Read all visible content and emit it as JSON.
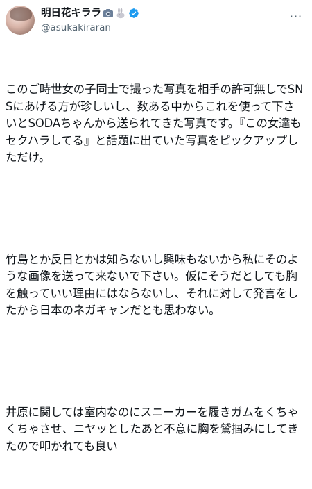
{
  "post": {
    "display_name": "明日花キララ",
    "handle": "@asukakiraran",
    "more_label": "···",
    "icons": {
      "verified": "verified-badge-icon",
      "more": "more-options-icon",
      "emoji1": "camera-emoji-icon",
      "emoji2": "rabbit-emoji-icon"
    },
    "accent_color": "#1d9bf0",
    "paragraphs": [
      "このご時世女の子同士で撮った写真を相手の許可無しでSNSにあげる方が珍しいし、数ある中からこれを使って下さいとSODAちゃんから送られてきた写真です。『この女達もセクハラしてる』と話題に出ていた写真をピックアップしただけ。",
      "竹島とか反日とかは知らないし興味もないから私にそのような画像を送って来ないで下さい。仮にそうだとしても胸を触っていい理由にはならないし、それに対して発言をしたから日本のネガキャンだとも思わない。",
      "井原に関しては室内なのにスニーカーを履きガムをくちゃくちゃさせ、ニヤッとしたあと不意に胸を鷲掴みにしてきたので叩かれても良い"
    ]
  }
}
